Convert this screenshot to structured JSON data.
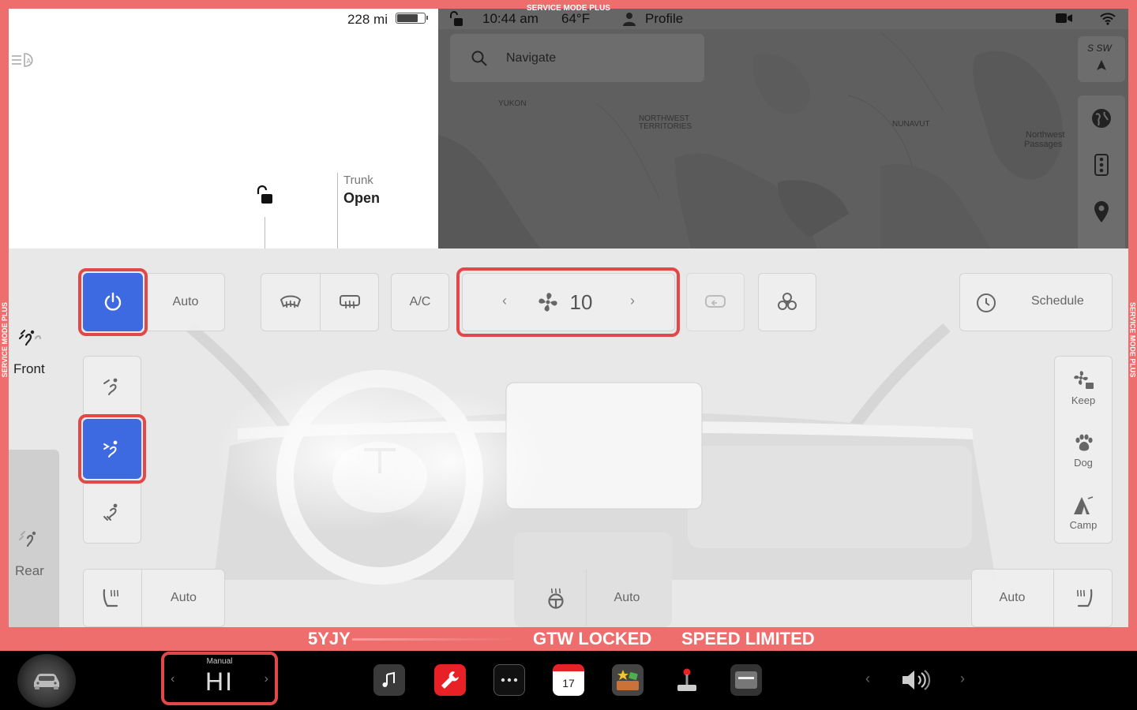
{
  "service_mode": {
    "top_label": "SERVICE MODE PLUS",
    "side_label": "SERVICE MODE PLUS"
  },
  "vehicle": {
    "range": "228 mi",
    "battery_level": 0.78,
    "trunk_label": "Trunk",
    "trunk_status": "Open"
  },
  "status_bar": {
    "time": "10:44 am",
    "temperature": "64°F",
    "profile": "Profile"
  },
  "map": {
    "search_placeholder": "Navigate",
    "compass": "S  SW",
    "labels": {
      "yukon": "YUKON",
      "nwt_1": "NORTHWEST",
      "nwt_2": "TERRITORIES",
      "nunavut": "NUNAVUT",
      "passages_1": "Northwest",
      "passages_2": "Passages"
    },
    "tools": [
      "globe-icon",
      "traffic-light-icon",
      "pin-icon"
    ]
  },
  "climate": {
    "zones": {
      "front": "Front",
      "rear": "Rear"
    },
    "power_on": true,
    "auto_label": "Auto",
    "ac_label": "A/C",
    "fan_speed": "10",
    "schedule_label": "Schedule",
    "side_modes": {
      "keep": "Keep",
      "dog": "Dog",
      "camp": "Camp"
    },
    "seat_left_auto": "Auto",
    "steering_auto": "Auto",
    "seat_right_auto": "Auto",
    "accent_color": "#3e6ae1",
    "highlight_color": "#e24848"
  },
  "warnings": {
    "vehicle_id": "5YJY",
    "gtw": "GTW LOCKED",
    "speed": "SPEED LIMITED",
    "color": "#ee6d6d"
  },
  "dock": {
    "temp_mode": "Manual",
    "temp_value": "HI",
    "apps": [
      "music-icon",
      "service-wrench-icon",
      "more-dots-icon",
      "calendar-icon",
      "toybox-icon",
      "joystick-icon",
      "dashcam-icon"
    ],
    "calendar_day": "17"
  }
}
